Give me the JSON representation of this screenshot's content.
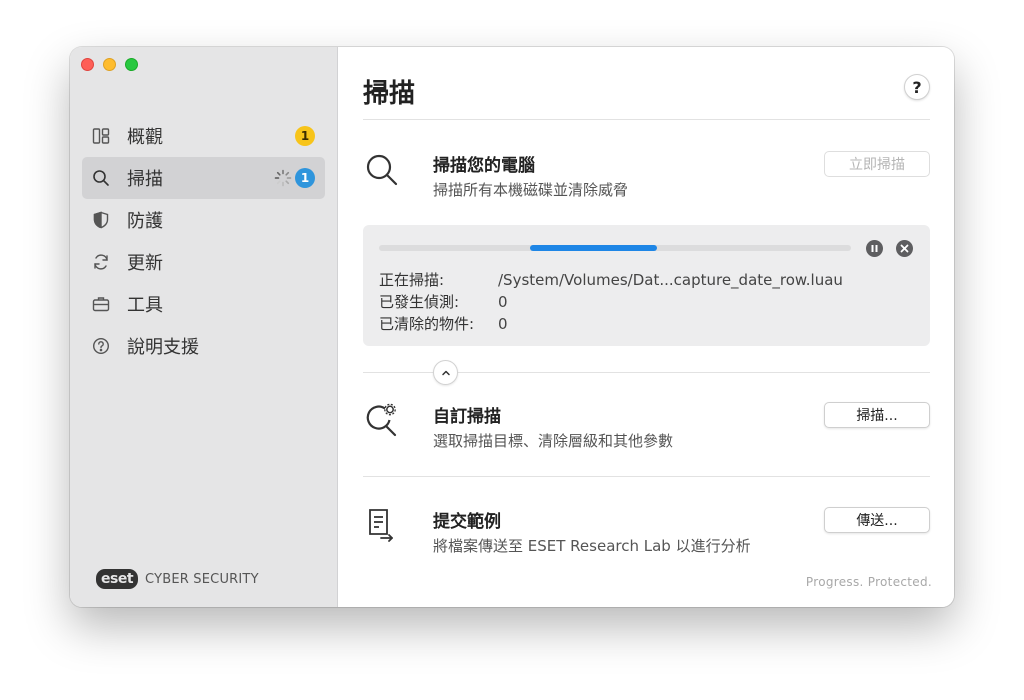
{
  "sidebar": {
    "items": [
      {
        "label": "概觀",
        "icon": "overview-icon",
        "badge": "1",
        "badge_color": "#f7c41a"
      },
      {
        "label": "掃描",
        "icon": "search-icon",
        "badge": "1",
        "badge_color": "#2f95dc"
      },
      {
        "label": "防護",
        "icon": "shield-icon"
      },
      {
        "label": "更新",
        "icon": "refresh-icon"
      },
      {
        "label": "工具",
        "icon": "briefcase-icon"
      },
      {
        "label": "說明支援",
        "icon": "help-circle-icon"
      }
    ],
    "brand": {
      "logo": "eset",
      "text": "CYBER SECURITY"
    }
  },
  "main": {
    "title": "掃描",
    "help_label": "?",
    "scan_computer": {
      "title": "掃描您的電腦",
      "description": "掃描所有本機磁碟並清除威脅",
      "button": "立即掃描"
    },
    "progress": {
      "percent_start": 0.32,
      "percent_end": 0.59,
      "rows": [
        {
          "label": "正在掃描:",
          "value": "/System/Volumes/Dat...capture_date_row.luau"
        },
        {
          "label": "已發生偵測:",
          "value": "0"
        },
        {
          "label": "已清除的物件:",
          "value": "0"
        }
      ]
    },
    "custom_scan": {
      "title": "自訂掃描",
      "description": "選取掃描目標、清除層級和其他參數",
      "button": "掃描..."
    },
    "submit_sample": {
      "title": "提交範例",
      "description": "將檔案傳送至 ESET Research Lab 以進行分析",
      "button": "傳送..."
    },
    "footer": "Progress. Protected."
  },
  "colors": {
    "accent": "#1e86e6",
    "sidebar_bg": "#e5e5e6"
  }
}
